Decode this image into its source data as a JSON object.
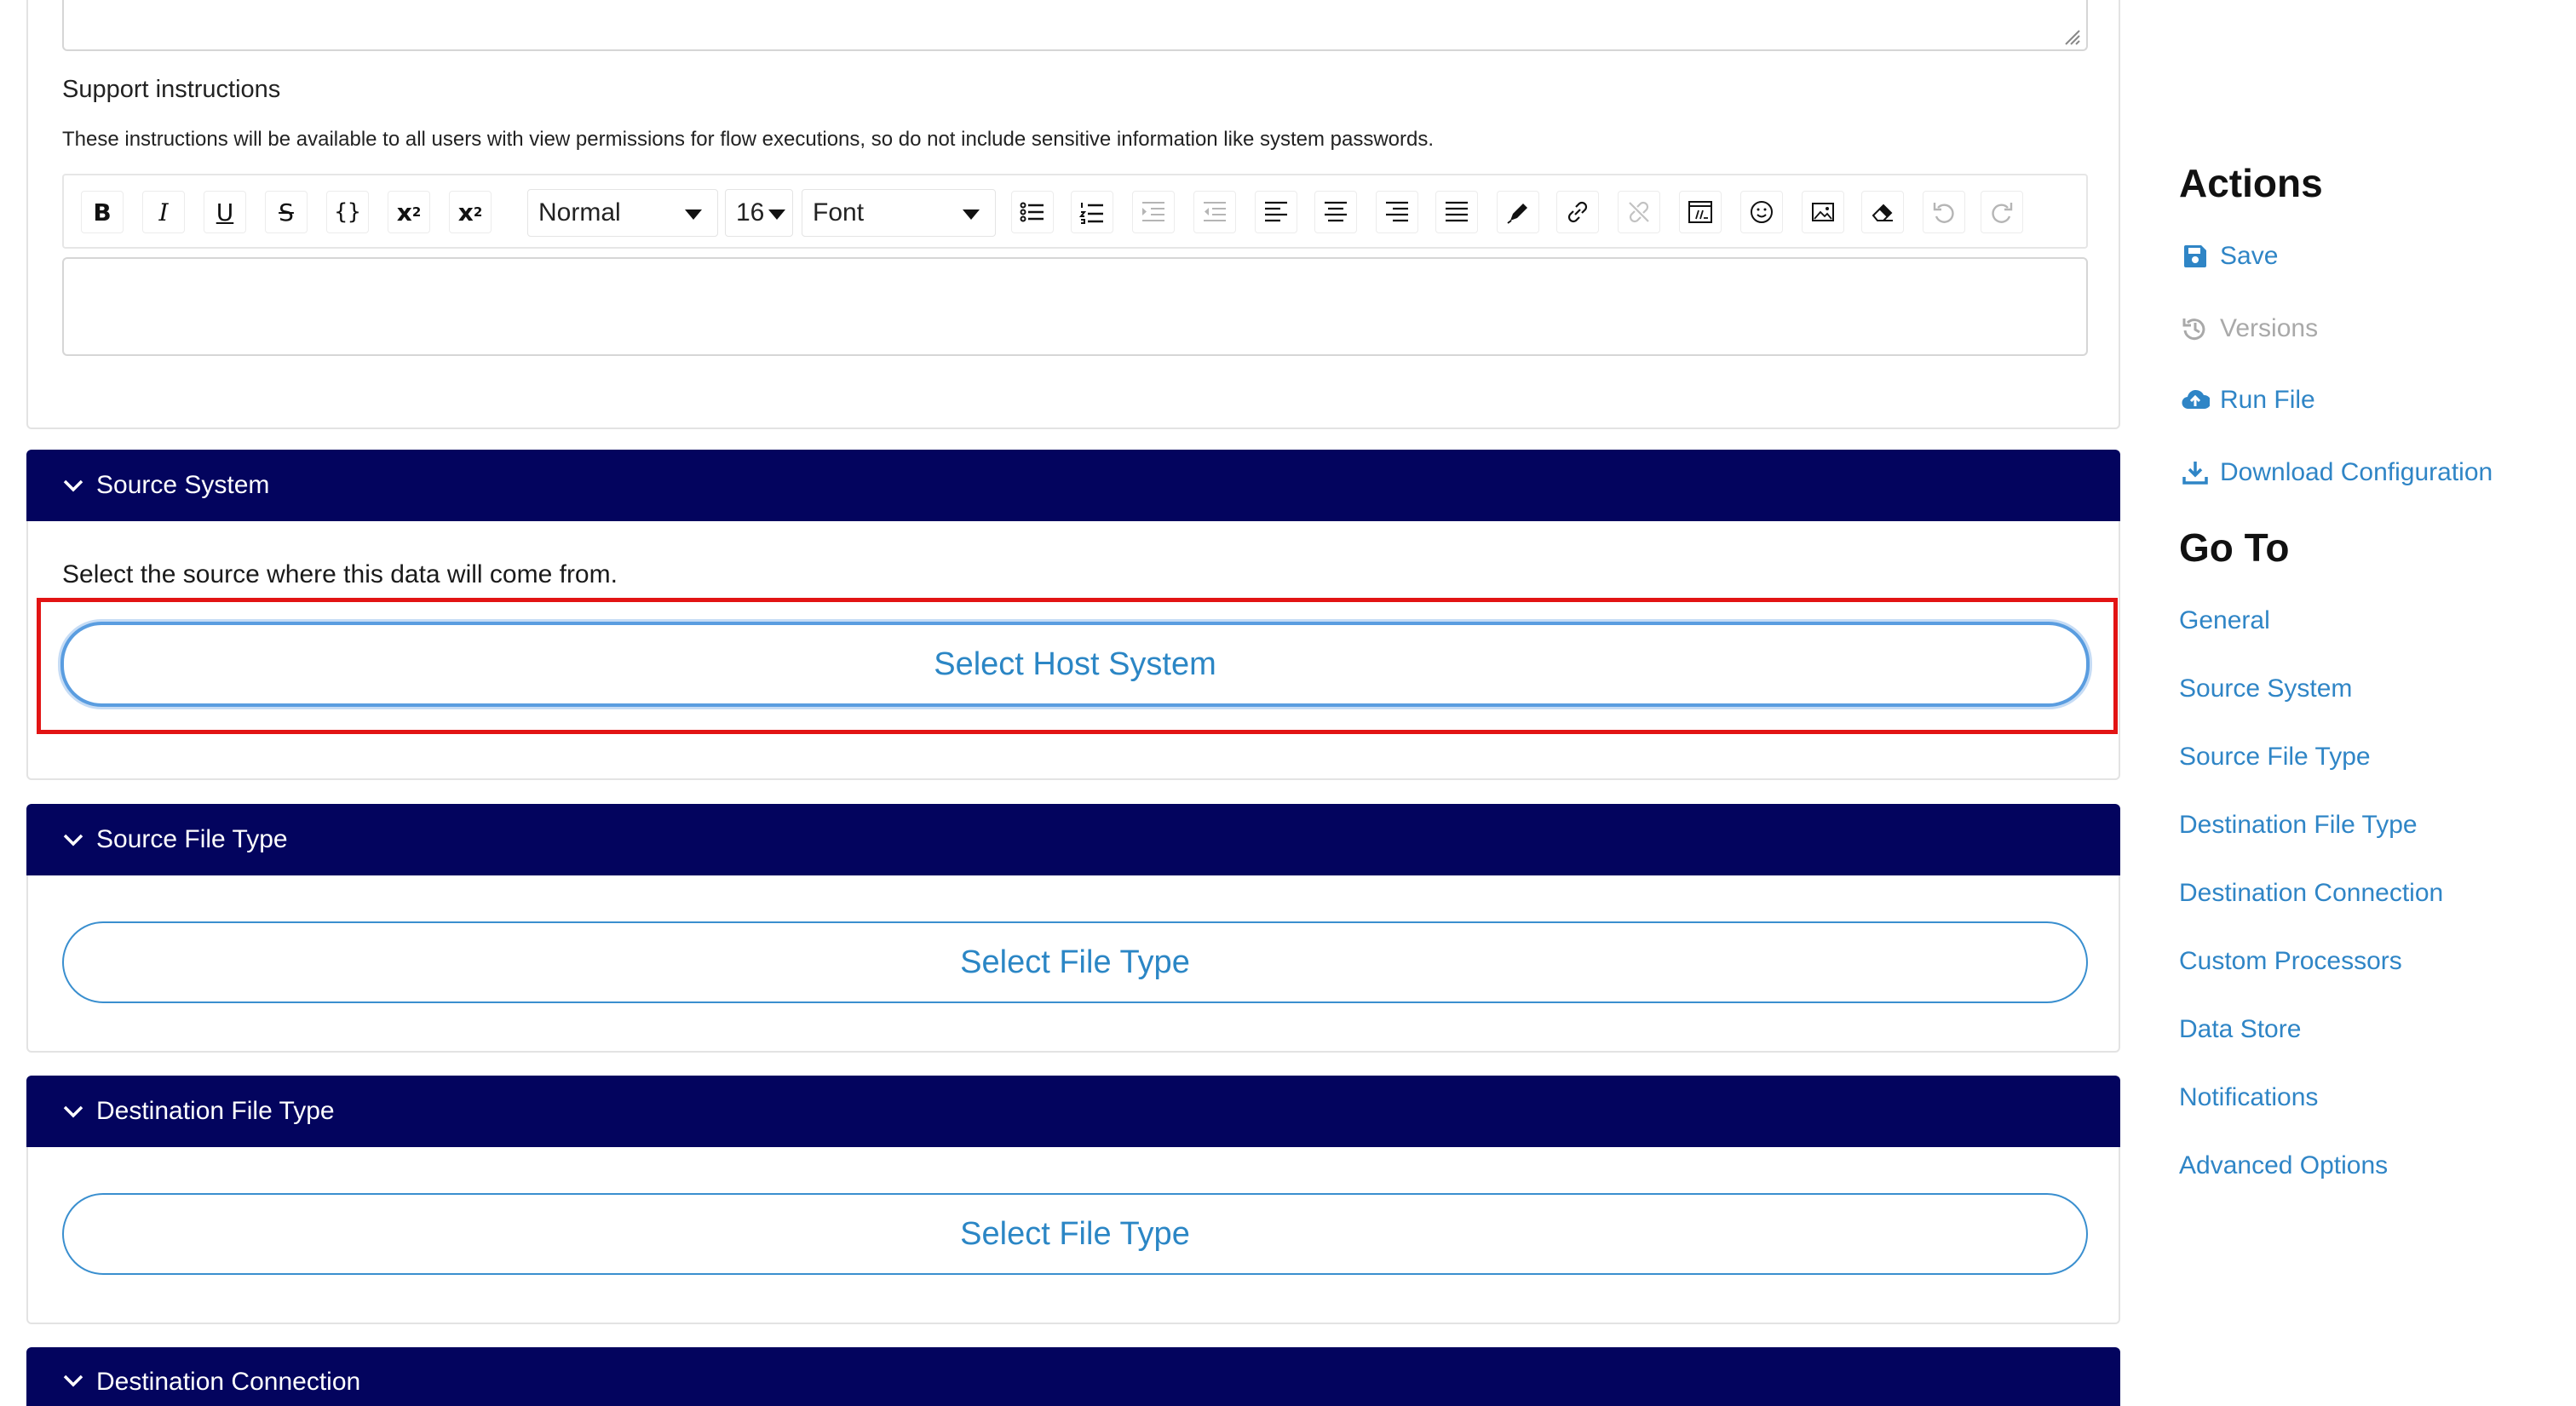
{
  "support": {
    "label": "Support instructions",
    "help": "These instructions will be available to all users with view permissions for flow executions, so do not include sensitive information like system passwords."
  },
  "toolbar": {
    "format_value": "Normal",
    "size_value": "16",
    "font_value": "Font",
    "buttons": [
      "bold",
      "italic",
      "underline",
      "strikethrough",
      "code",
      "superscript",
      "subscript",
      "bulleted-list",
      "numbered-list",
      "indent",
      "outdent",
      "align-left",
      "align-center",
      "align-right",
      "justify",
      "text-color",
      "link",
      "unlink",
      "code-block",
      "emoji",
      "image",
      "eraser",
      "undo",
      "redo"
    ]
  },
  "sections": {
    "source_system": {
      "title": "Source System",
      "description": "Select the source where this data will come from.",
      "button": "Select Host System"
    },
    "source_file_type": {
      "title": "Source File Type",
      "button": "Select File Type"
    },
    "destination_file_type": {
      "title": "Destination File Type",
      "button": "Select File Type"
    },
    "destination_connection": {
      "title": "Destination Connection"
    }
  },
  "sidebar": {
    "actions_heading": "Actions",
    "actions": {
      "save": "Save",
      "versions": "Versions",
      "run_file": "Run File",
      "download_configuration": "Download Configuration"
    },
    "goto_heading": "Go To",
    "goto": [
      "General",
      "Source System",
      "Source File Type",
      "Destination File Type",
      "Destination Connection",
      "Custom Processors",
      "Data Store",
      "Notifications",
      "Advanced Options"
    ]
  },
  "colors": {
    "section_header": "#03045e",
    "link": "#2f85c6",
    "highlight": "#e21414"
  }
}
